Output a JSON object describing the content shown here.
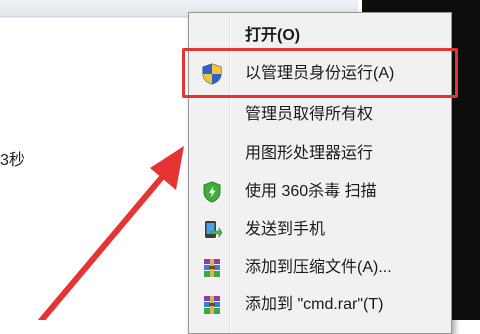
{
  "background": {
    "partial_text": "3秒"
  },
  "context_menu": {
    "items": [
      {
        "label": "打开(O)",
        "bold": true,
        "icon": "none"
      },
      {
        "label": "以管理员身份运行(A)",
        "icon": "uac-shield-icon"
      },
      {
        "label": "管理员取得所有权",
        "icon": "none"
      },
      {
        "label": "用图形处理器运行",
        "icon": "none"
      },
      {
        "label": "使用 360杀毒 扫描",
        "icon": "360-antivirus-icon"
      },
      {
        "label": "发送到手机",
        "icon": "send-to-phone-icon"
      },
      {
        "label": "添加到压缩文件(A)...",
        "icon": "winrar-icon"
      },
      {
        "label": "添加到 \"cmd.rar\"(T)",
        "icon": "winrar-icon"
      }
    ]
  },
  "annotation": {
    "highlight_color": "#e63333",
    "arrow_color": "#e63333"
  }
}
